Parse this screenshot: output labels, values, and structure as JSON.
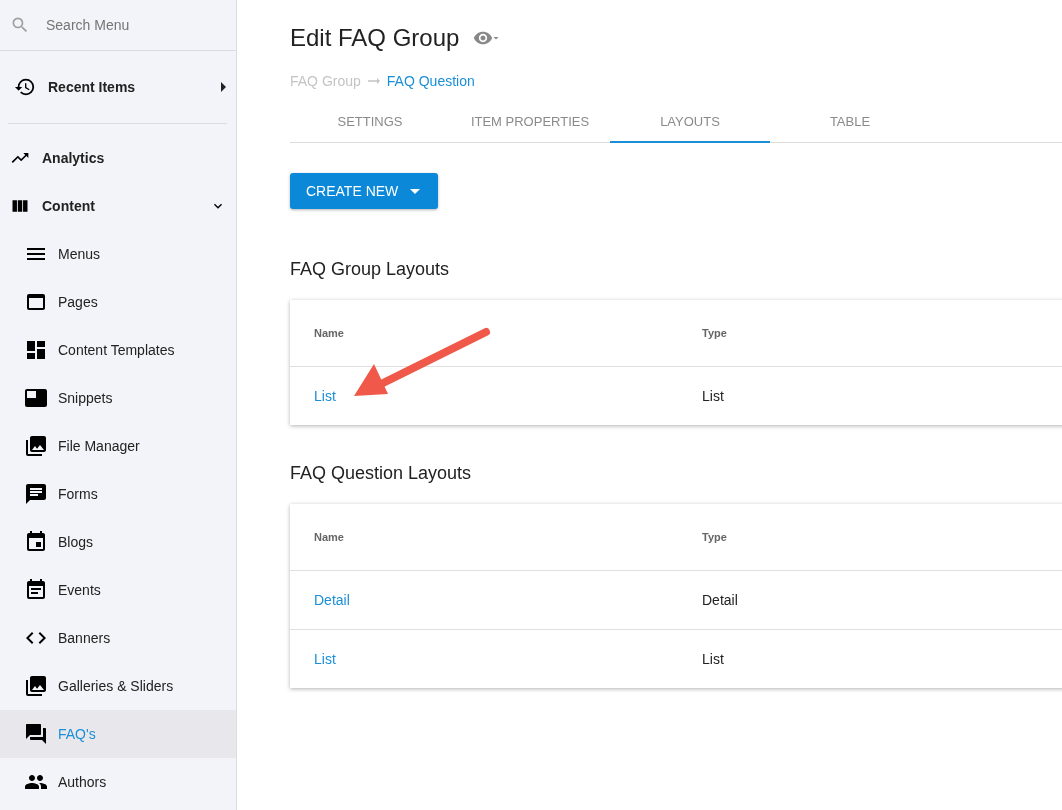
{
  "sidebar": {
    "search": {
      "placeholder": "Search Menu"
    },
    "recent_items": {
      "label": "Recent Items"
    },
    "nav": [
      {
        "label": "Analytics",
        "selected": false
      },
      {
        "label": "Content",
        "selected": false,
        "expanded": true,
        "children": [
          {
            "label": "Menus",
            "selected": false
          },
          {
            "label": "Pages",
            "selected": false
          },
          {
            "label": "Content Templates",
            "selected": false
          },
          {
            "label": "Snippets",
            "selected": false
          },
          {
            "label": "File Manager",
            "selected": false
          },
          {
            "label": "Forms",
            "selected": false
          },
          {
            "label": "Blogs",
            "selected": false
          },
          {
            "label": "Events",
            "selected": false
          },
          {
            "label": "Banners",
            "selected": false
          },
          {
            "label": "Galleries & Sliders",
            "selected": false
          },
          {
            "label": "FAQ's",
            "selected": true
          },
          {
            "label": "Authors",
            "selected": false
          }
        ]
      }
    ]
  },
  "page": {
    "title": "Edit FAQ Group",
    "breadcrumb": [
      {
        "label": "FAQ Group",
        "selected": false
      },
      {
        "label": "FAQ Question",
        "selected": true
      }
    ],
    "tabs": [
      {
        "label": "SETTINGS",
        "selected": false
      },
      {
        "label": "ITEM PROPERTIES",
        "selected": false
      },
      {
        "label": "LAYOUTS",
        "selected": true
      },
      {
        "label": "TABLE",
        "selected": false
      }
    ],
    "create_button": "CREATE NEW",
    "sections": [
      {
        "title": "FAQ Group Layouts",
        "columns": [
          "Name",
          "Type"
        ],
        "annotated": true,
        "rows": [
          {
            "name": "List",
            "type": "List"
          }
        ]
      },
      {
        "title": "FAQ Question Layouts",
        "columns": [
          "Name",
          "Type"
        ],
        "annotated": false,
        "rows": [
          {
            "name": "Detail",
            "type": "Detail"
          },
          {
            "name": "List",
            "type": "List"
          }
        ]
      }
    ]
  }
}
